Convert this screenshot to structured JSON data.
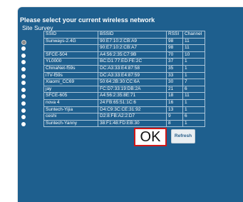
{
  "dialog": {
    "title": "Please select your current wireless network",
    "subtitle": "Site Survey"
  },
  "table": {
    "headers": [
      "SSID",
      "BSSID",
      "RSSI",
      "Channel"
    ],
    "rows": [
      {
        "ssid": "Sunways-2.4G",
        "bssid": "90:E7:10:2:CB:A9",
        "rssi": "98",
        "channel": "11",
        "selected": true
      },
      {
        "ssid": "",
        "bssid": "90:E7:10:2:CB:A7",
        "rssi": "98",
        "channel": "11",
        "selected": false
      },
      {
        "ssid": "SFCE-504",
        "bssid": "A4:56:2:35:C7:9B",
        "rssi": "70",
        "channel": "10",
        "selected": false
      },
      {
        "ssid": "YL0000",
        "bssid": "BC:D1:77:ED:FE:2C",
        "rssi": "37",
        "channel": "1",
        "selected": false
      },
      {
        "ssid": "ChinaNet-f59s",
        "bssid": "DC:A3:33:E4:87:58",
        "rssi": "35",
        "channel": "1",
        "selected": false
      },
      {
        "ssid": "iTV-f59s",
        "bssid": "DC:A3:33:E4:87:59",
        "rssi": "33",
        "channel": "1",
        "selected": false
      },
      {
        "ssid": "Xiaomi_CC69",
        "bssid": "50:64:2B:30:CC:6A",
        "rssi": "30",
        "channel": "7",
        "selected": false
      },
      {
        "ssid": "jay",
        "bssid": "FC:D7:33:19:DB:2A",
        "rssi": "21",
        "channel": "6",
        "selected": false
      },
      {
        "ssid": "SFCE-605",
        "bssid": "A4:56:2:35:8E:71",
        "rssi": "18",
        "channel": "11",
        "selected": false
      },
      {
        "ssid": "nova 4",
        "bssid": "24:FB:65:51:1C:6",
        "rssi": "16",
        "channel": "1",
        "selected": false
      },
      {
        "ssid": "Suntech-Yijia",
        "bssid": "D4:C9:3C:CE:31:92",
        "rssi": "13",
        "channel": "1",
        "selected": false
      },
      {
        "ssid": "ceshi",
        "bssid": "D2:8:FB:A2:2:D7",
        "rssi": "9",
        "channel": "6",
        "selected": false
      },
      {
        "ssid": "Suntech-Yanny",
        "bssid": "38:F1:48:FD:EB:30",
        "rssi": "8",
        "channel": "1",
        "selected": false
      }
    ]
  },
  "buttons": {
    "ok_label": "OK",
    "refresh_label": "Refresh"
  },
  "colors": {
    "panel": "#1e5f8e",
    "ok_border": "#d01818"
  }
}
